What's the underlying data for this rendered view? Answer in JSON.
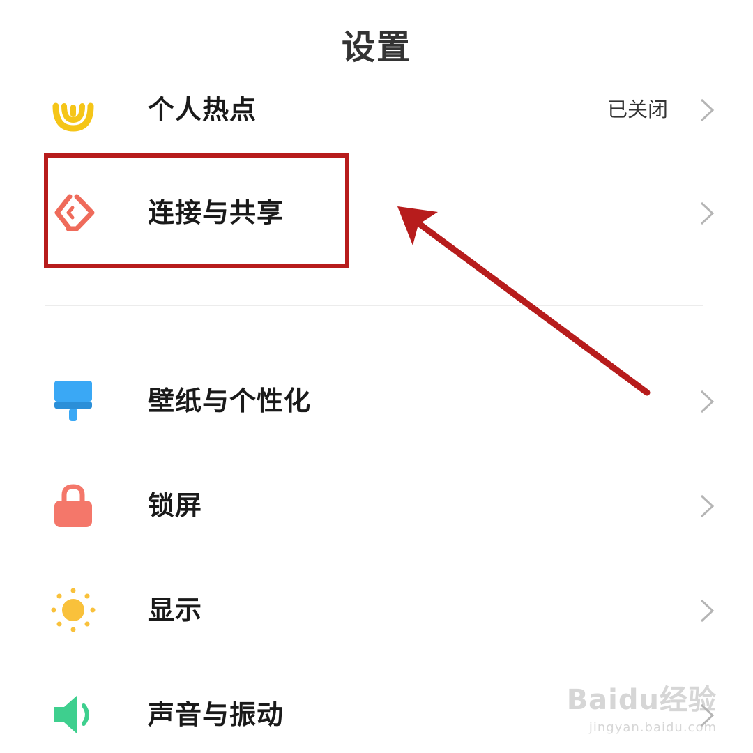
{
  "header": {
    "title": "设置"
  },
  "rows": [
    {
      "label": "个人热点",
      "value": "已关闭",
      "icon": "hotspot-icon"
    },
    {
      "label": "连接与共享",
      "icon": "connect-share-icon"
    },
    {
      "label": "壁纸与个性化",
      "icon": "brush-icon"
    },
    {
      "label": "锁屏",
      "icon": "lock-icon"
    },
    {
      "label": "显示",
      "icon": "sun-icon"
    },
    {
      "label": "声音与振动",
      "icon": "speaker-icon"
    }
  ],
  "colors": {
    "highlight": "#b71c1c",
    "hotspot": "#f5c518",
    "connect": "#ef6b5b",
    "brush": "#3aa8f5",
    "lock": "#f4776a",
    "sun": "#f9c13b",
    "speaker": "#3ecf8e"
  },
  "watermark": {
    "brand": "Baidu经验",
    "site": "jingyan.baidu.com"
  }
}
